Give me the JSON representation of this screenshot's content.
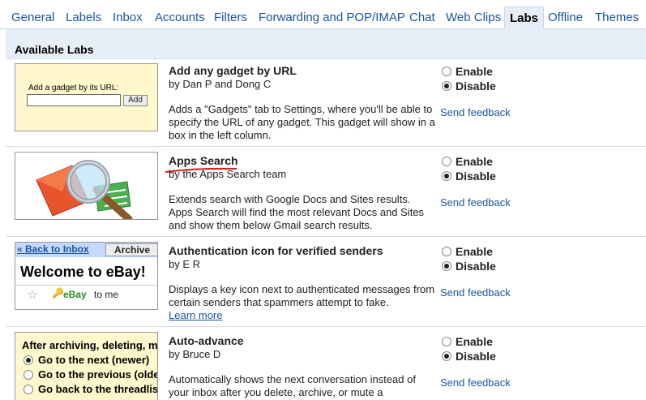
{
  "tabs": [
    {
      "label": "General",
      "active": false
    },
    {
      "label": "Labels",
      "active": false
    },
    {
      "label": "Inbox",
      "active": false
    },
    {
      "label": "Accounts",
      "active": false
    },
    {
      "label": "Filters",
      "active": false
    },
    {
      "label": "Forwarding and POP/IMAP",
      "active": false
    },
    {
      "label": "Chat",
      "active": false
    },
    {
      "label": "Web Clips",
      "active": false
    },
    {
      "label": "Labs",
      "active": true
    },
    {
      "label": "Offline",
      "active": false
    },
    {
      "label": "Themes",
      "active": false
    }
  ],
  "section_title": "Available Labs",
  "enable_label": "Enable",
  "disable_label": "Disable",
  "feedback_label": "Send feedback",
  "labs": [
    {
      "title": "Add any gadget by URL",
      "author": "by Dan P and Dong C",
      "description": "Adds a \"Gadgets\" tab to Settings, where you'll be able to specify the URL of any gadget. This gadget will show in a box in the left column.",
      "selected": "disable",
      "thumb": {
        "label": "Add a gadget by its URL:",
        "button": "Add"
      }
    },
    {
      "title": "Apps Search",
      "author": "by the Apps Search team",
      "description": "Extends search with Google Docs and Sites results. Apps Search will find the most relevant Docs and Sites and show them below Gmail search results.",
      "selected": "disable",
      "thumb": {
        "icon": "magnifier-envelope-icon"
      }
    },
    {
      "title": "Authentication icon for verified senders",
      "author": "by E R",
      "description": "Displays a key icon next to authenticated messages from certain senders that spammers attempt to fake.",
      "learn_more": "Learn more",
      "selected": "disable",
      "thumb": {
        "back": "« Back to Inbox",
        "archive": "Archive",
        "welcome": "Welcome to eBay!",
        "sender": "eBay",
        "to": "to me"
      }
    },
    {
      "title": "Auto-advance",
      "author": "by Bruce D",
      "description": "Automatically shows the next conversation instead of your inbox after you delete, archive, or mute a",
      "selected": "disable",
      "thumb": {
        "head": "After archiving, deleting, m",
        "options": [
          "Go to the next (newer)",
          "Go to the previous (older",
          "Go back to the threadlis"
        ],
        "selected_index": 0
      }
    }
  ],
  "colors": {
    "link": "#1a55a5",
    "panel": "#e8eef7",
    "thumb_yellow": "#fff8cc",
    "underline_red": "#d02020"
  }
}
